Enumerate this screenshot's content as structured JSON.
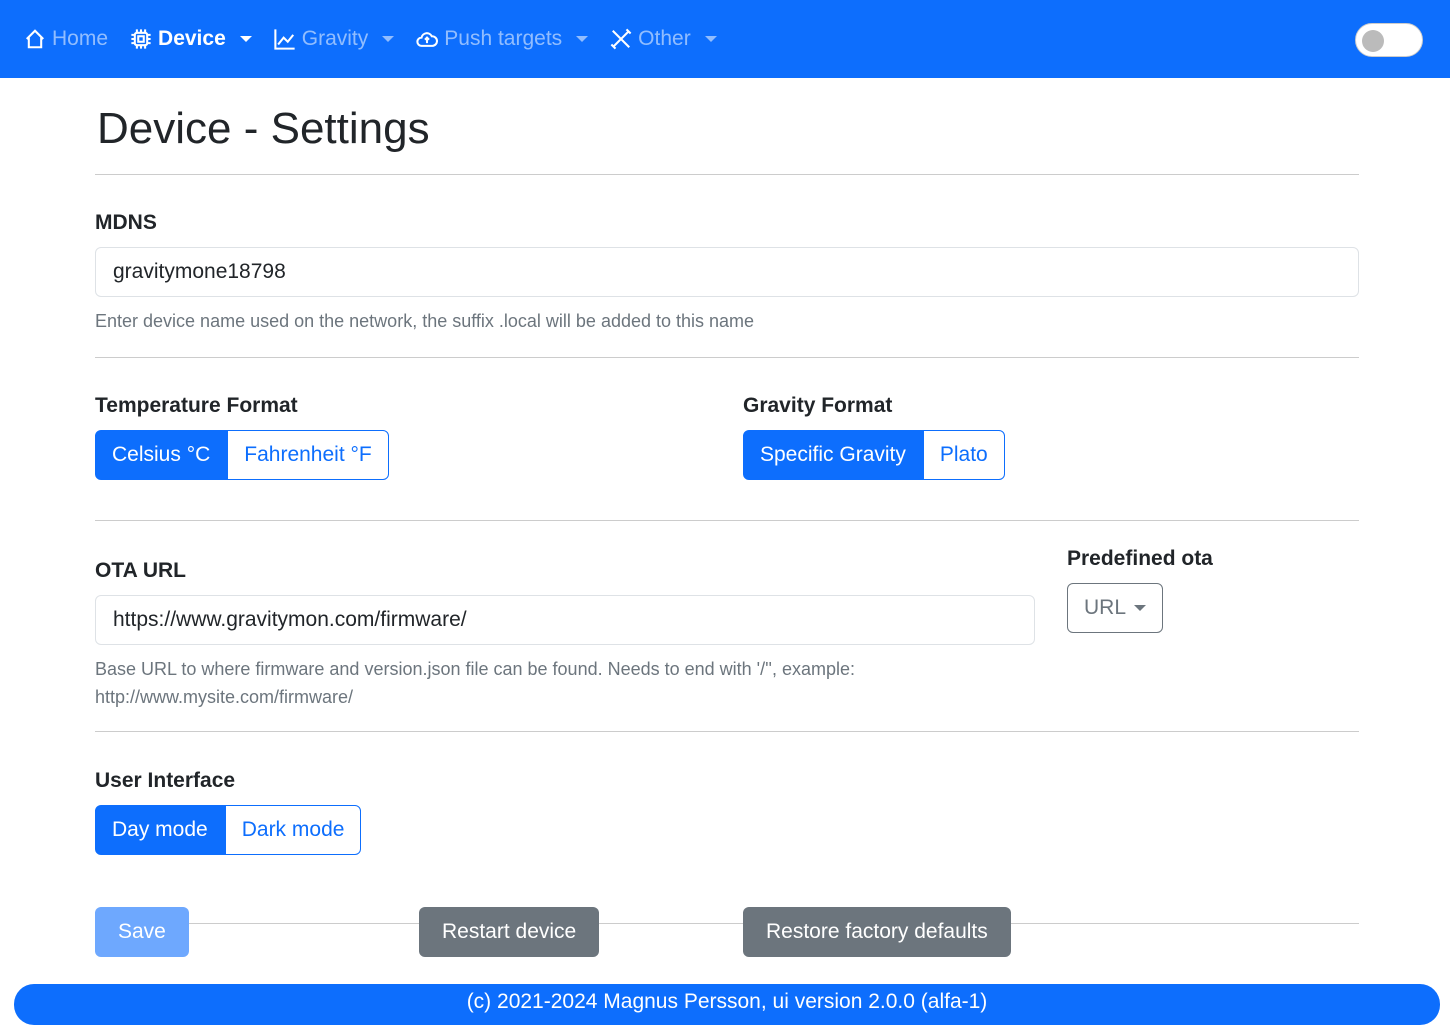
{
  "nav": {
    "items": [
      {
        "label": "Home",
        "icon": "house-icon"
      },
      {
        "label": "Device",
        "icon": "cpu-icon"
      },
      {
        "label": "Gravity",
        "icon": "chart-icon"
      },
      {
        "label": "Push targets",
        "icon": "cloud-upload-icon"
      },
      {
        "label": "Other",
        "icon": "tools-icon"
      }
    ]
  },
  "page": {
    "title": "Device - Settings"
  },
  "mdns": {
    "label": "MDNS",
    "value": "gravitymone18798",
    "help": "Enter device name used on the network, the suffix .local will be added to this name"
  },
  "temp": {
    "label": "Temperature Format",
    "options": [
      "Celsius °C",
      "Fahrenheit °F"
    ],
    "selected": "Celsius °C"
  },
  "gravity": {
    "label": "Gravity Format",
    "options": [
      "Specific Gravity",
      "Plato"
    ],
    "selected": "Specific Gravity"
  },
  "ota": {
    "label": "OTA URL",
    "value": "https://www.gravitymon.com/firmware/",
    "help1": "Base URL to where firmware and version.json file can be found. Needs to end with '/'', example:",
    "help2": "http://www.mysite.com/firmware/",
    "predef_label": "Predefined ota",
    "predef_button": "URL"
  },
  "ui": {
    "label": "User Interface",
    "options": [
      "Day mode",
      "Dark mode"
    ],
    "selected": "Day mode"
  },
  "buttons": {
    "save": "Save",
    "restart": "Restart device",
    "restore": "Restore factory defaults"
  },
  "footer": "(c) 2021-2024 Magnus Persson, ui version 2.0.0 (alfa-1)"
}
